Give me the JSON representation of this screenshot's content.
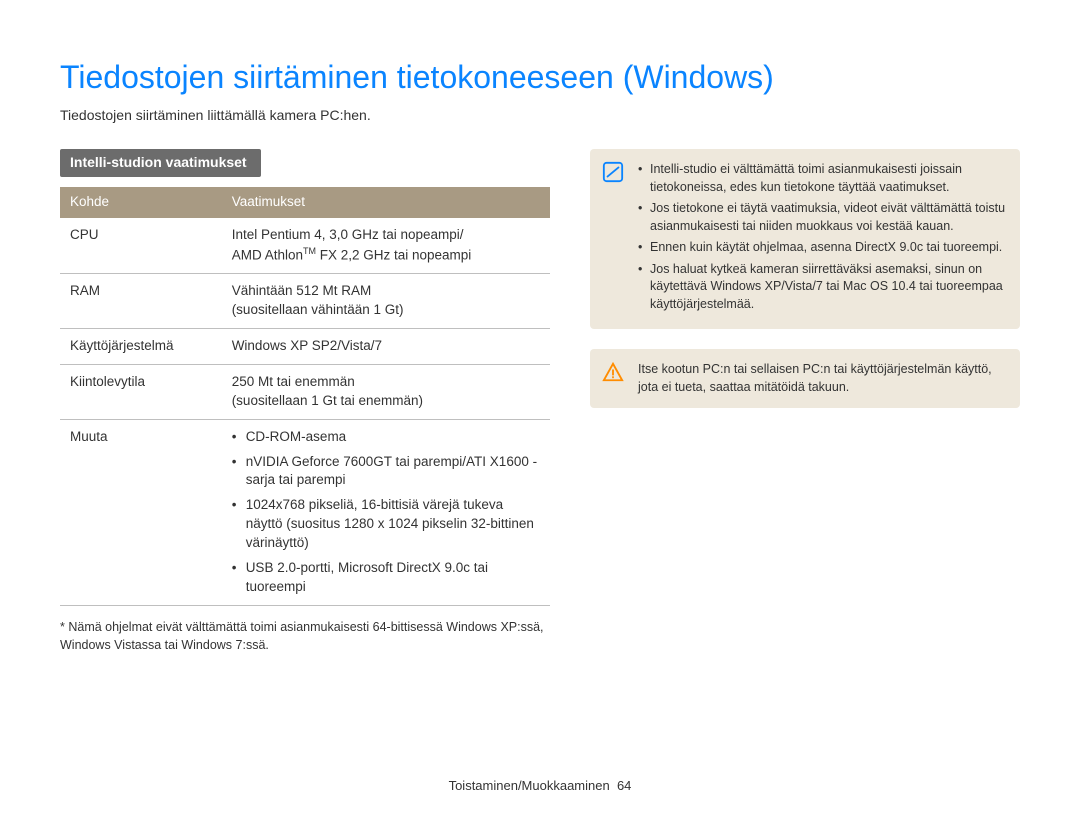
{
  "title": "Tiedostojen siirtäminen tietokoneeseen (Windows)",
  "intro": "Tiedostojen siirtäminen liittämällä kamera PC:hen.",
  "section_tag": "Intelli-studion vaatimukset",
  "table": {
    "head": {
      "col1": "Kohde",
      "col2": "Vaatimukset"
    },
    "rows": [
      {
        "k": "CPU",
        "v": "Intel Pentium 4, 3,0 GHz tai nopeampi/\nAMD Athlon™ FX 2,2 GHz tai nopeampi"
      },
      {
        "k": "RAM",
        "v": "Vähintään 512 Mt RAM\n(suositellaan vähintään 1 Gt)"
      },
      {
        "k": "Käyttöjärjestelmä",
        "v": "Windows XP SP2/Vista/7"
      },
      {
        "k": "Kiintolevytila",
        "v": "250 Mt tai enemmän\n(suositellaan 1 Gt tai enemmän)"
      }
    ],
    "muuta_label": "Muuta",
    "muuta_items": [
      "CD-ROM-asema",
      "nVIDIA Geforce 7600GT tai parempi/ATI X1600 -sarja tai parempi",
      "1024x768 pikseliä, 16-bittisiä värejä tukeva näyttö (suositus 1280 x 1024 pikselin 32-bittinen värinäyttö)",
      "USB 2.0-portti, Microsoft DirectX 9.0c tai tuoreempi"
    ]
  },
  "footnote": "* Nämä ohjelmat eivät välttämättä toimi asianmukaisesti 64-bittisessä Windows XP:ssä, Windows Vistassa tai Windows 7:ssä.",
  "info_items": [
    "Intelli-studio ei välttämättä toimi asianmukaisesti joissain tietokoneissa, edes kun tietokone täyttää vaatimukset.",
    "Jos tietokone ei täytä vaatimuksia, videot eivät välttämättä toistu asianmukaisesti tai niiden muokkaus voi kestää kauan.",
    "Ennen kuin käytät ohjelmaa, asenna DirectX 9.0c tai tuoreempi.",
    "Jos haluat kytkeä kameran siirrettäväksi asemaksi, sinun on käytettävä Windows XP/Vista/7 tai Mac OS 10.4 tai tuoreempaa käyttöjärjestelmää."
  ],
  "warn_text": "Itse kootun PC:n tai sellaisen PC:n tai käyttöjärjestelmän käyttö, jota ei tueta, saattaa mitätöidä takuun.",
  "footer": {
    "section": "Toistaminen/Muokkaaminen",
    "page": "64"
  }
}
